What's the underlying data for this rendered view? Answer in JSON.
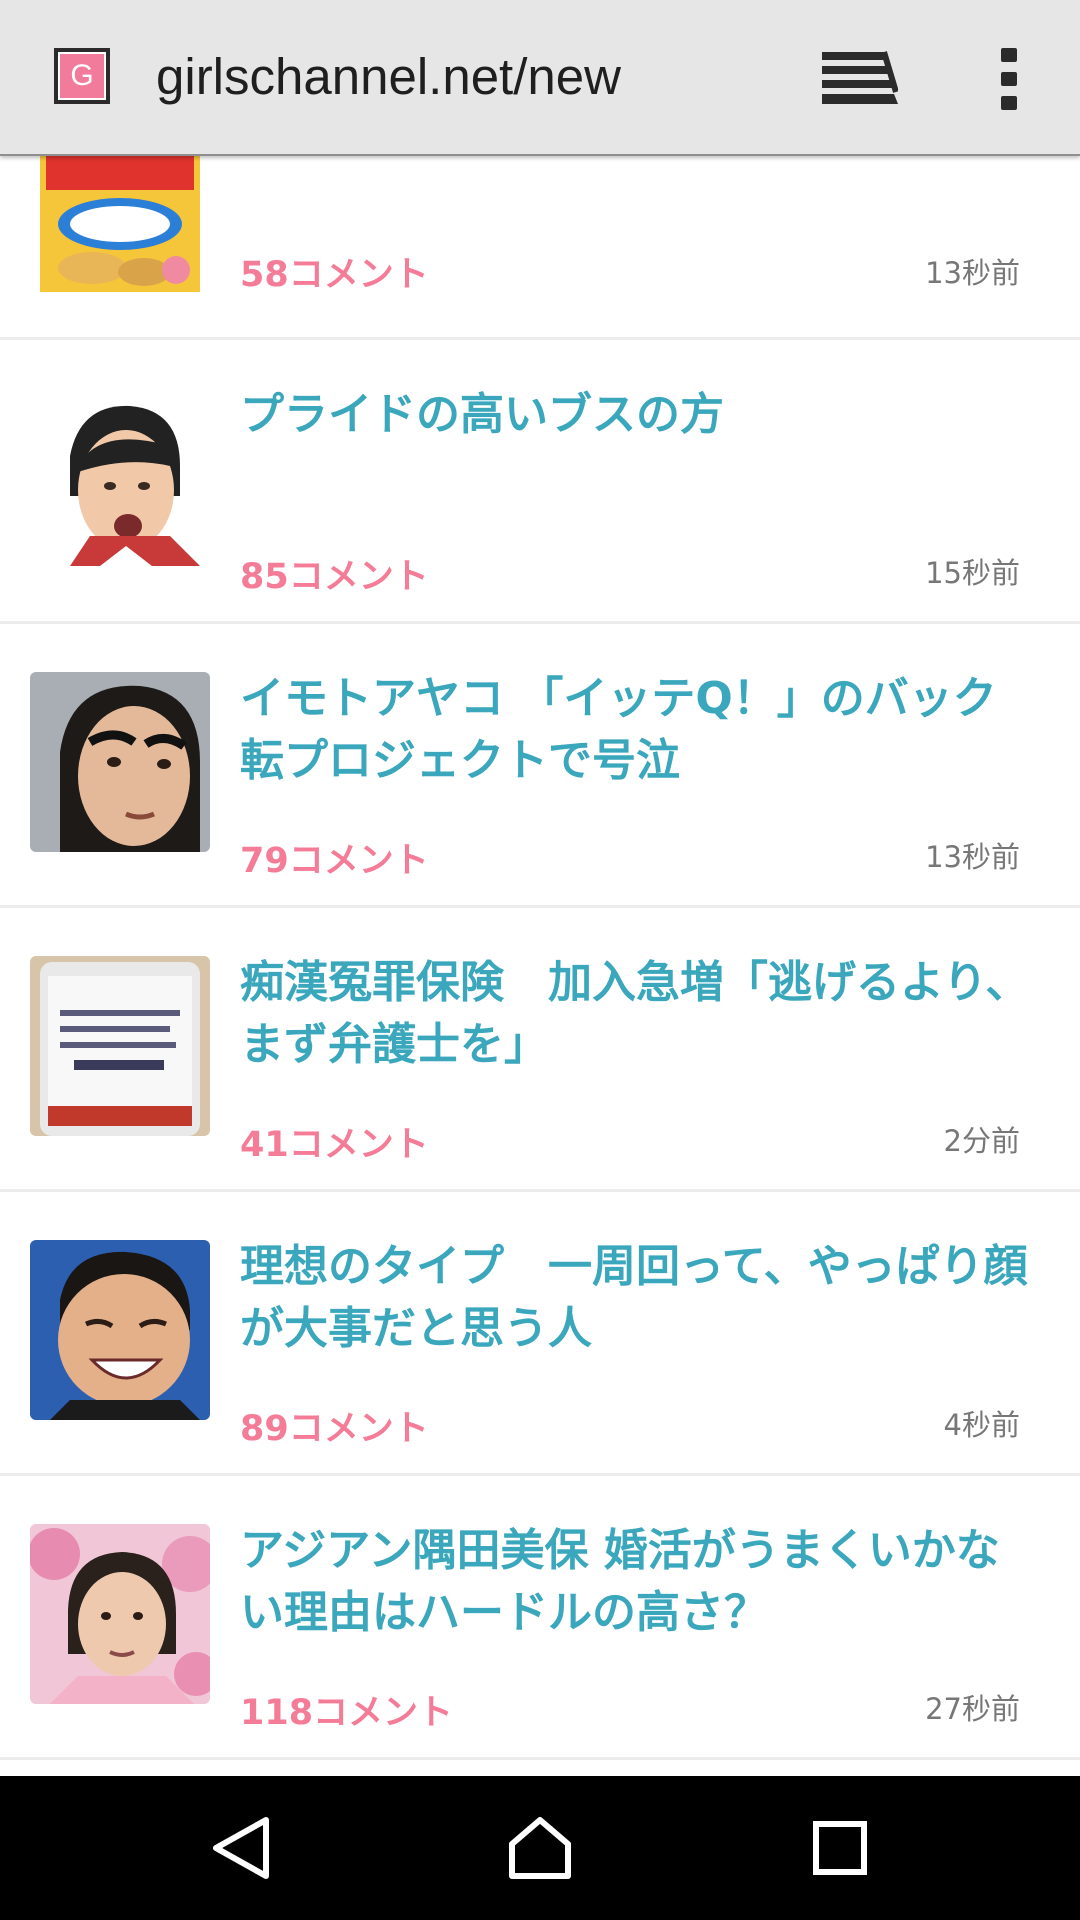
{
  "browser": {
    "favicon_letter": "G",
    "url": "girlschannel.net/new",
    "tabs_icon": "tab-stack-icon",
    "menu_icon": "overflow-menu-icon"
  },
  "articles": [
    {
      "title": "",
      "comments": "58コメント",
      "time": "13秒前",
      "thumb": "potato-chips-bag"
    },
    {
      "title": "プライドの高いブスの方",
      "comments": "85コメント",
      "time": "15秒前",
      "thumb": "woman-portrait"
    },
    {
      "title": "イモトアヤコ 「イッテQ！」のバック転プロジェクトで号泣",
      "comments": "79コメント",
      "time": "13秒前",
      "thumb": "woman-thick-eyebrows"
    },
    {
      "title": "痴漢冤罪保険　加入急増「逃げるより、まず弁護士を」",
      "comments": "41コメント",
      "time": "2分前",
      "thumb": "smartphone-screen"
    },
    {
      "title": "理想のタイプ　一周回って、やっぱり顔が大事だと思う人",
      "comments": "89コメント",
      "time": "4秒前",
      "thumb": "smiling-man"
    },
    {
      "title": "アジアン隅田美保 婚活がうまくいかない理由はハードルの高さ？",
      "comments": "118コメント",
      "time": "27秒前",
      "thumb": "woman-pink-background"
    }
  ],
  "colors": {
    "title": "#3aa7bd",
    "comments": "#f47c97",
    "time": "#777777",
    "toolbar": "#e6e6e6",
    "navbar": "#000000"
  },
  "navbar": {
    "back_icon": "back-triangle-icon",
    "home_icon": "home-icon",
    "recents_icon": "recents-square-icon"
  }
}
